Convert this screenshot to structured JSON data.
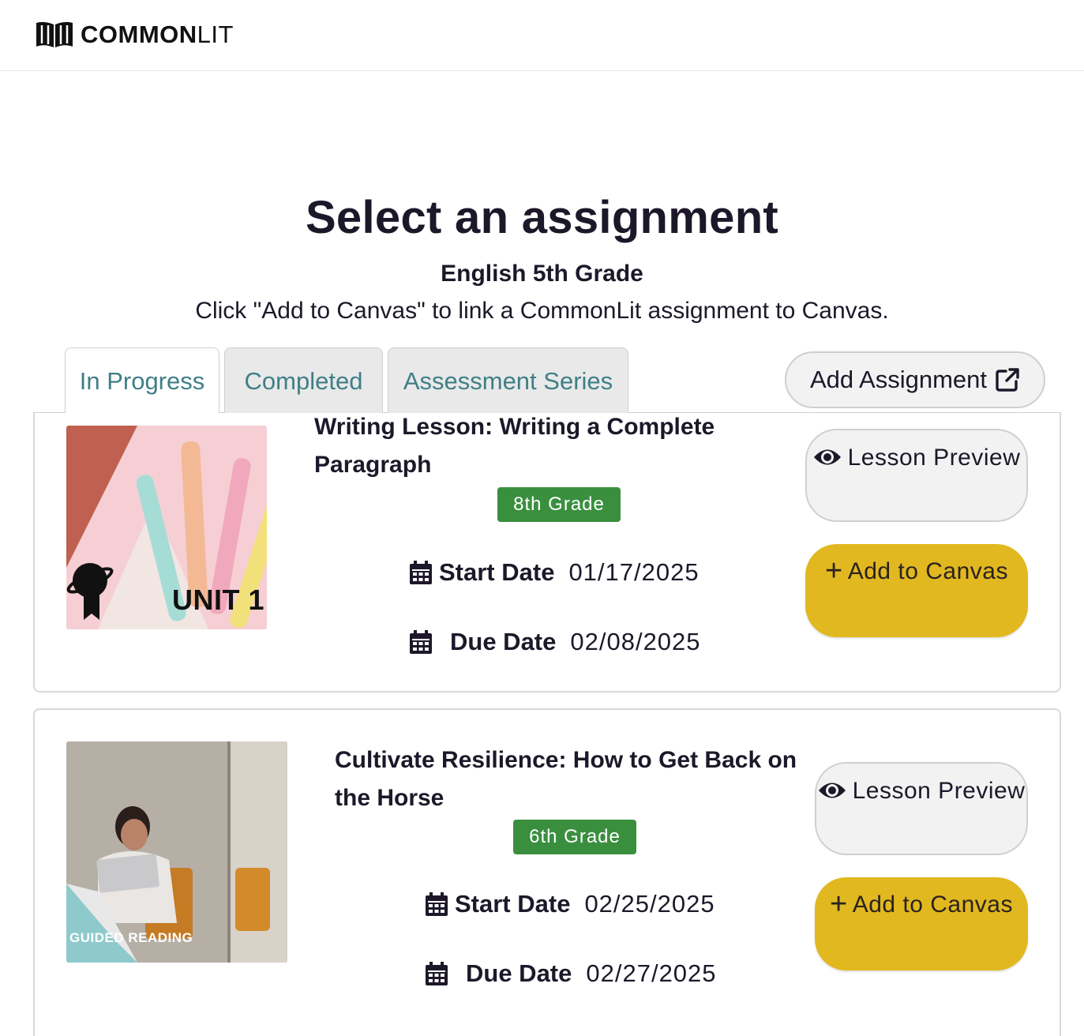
{
  "brand": {
    "logo_bold": "COMMON",
    "logo_light": "LIT"
  },
  "page": {
    "heading": "Select an assignment",
    "course": "English 5th Grade",
    "instruction": "Click \"Add to Canvas\" to link a CommonLit assignment to Canvas."
  },
  "tabs": [
    {
      "label": "In Progress",
      "active": true
    },
    {
      "label": "Completed",
      "active": false
    },
    {
      "label": "Assessment Series",
      "active": false
    }
  ],
  "add_assignment": {
    "label": "Add Assignment",
    "icon": "external-link-icon"
  },
  "assignments": [
    {
      "title": "Writing Lesson: Writing a Complete Paragraph",
      "grade": "8th Grade",
      "thumbnail_label": "UNIT 1",
      "start_label": "Start Date",
      "start_date": "01/17/2025",
      "due_label": "Due Date",
      "due_date": "02/08/2025",
      "preview_label": "Lesson Preview",
      "add_label": "Add to Canvas"
    },
    {
      "title": "Cultivate Resilience: How to Get Back on the Horse",
      "grade": "6th Grade",
      "thumbnail_label": "GUIDED READING",
      "start_label": "Start Date",
      "start_date": "02/25/2025",
      "due_label": "Due Date",
      "due_date": "02/27/2025",
      "preview_label": "Lesson Preview",
      "add_label": "Add to Canvas"
    }
  ],
  "colors": {
    "tab_text": "#3f7f86",
    "grade_badge": "#3a8f3f",
    "add_button": "#e1b81f",
    "heading_text": "#1d1829"
  }
}
